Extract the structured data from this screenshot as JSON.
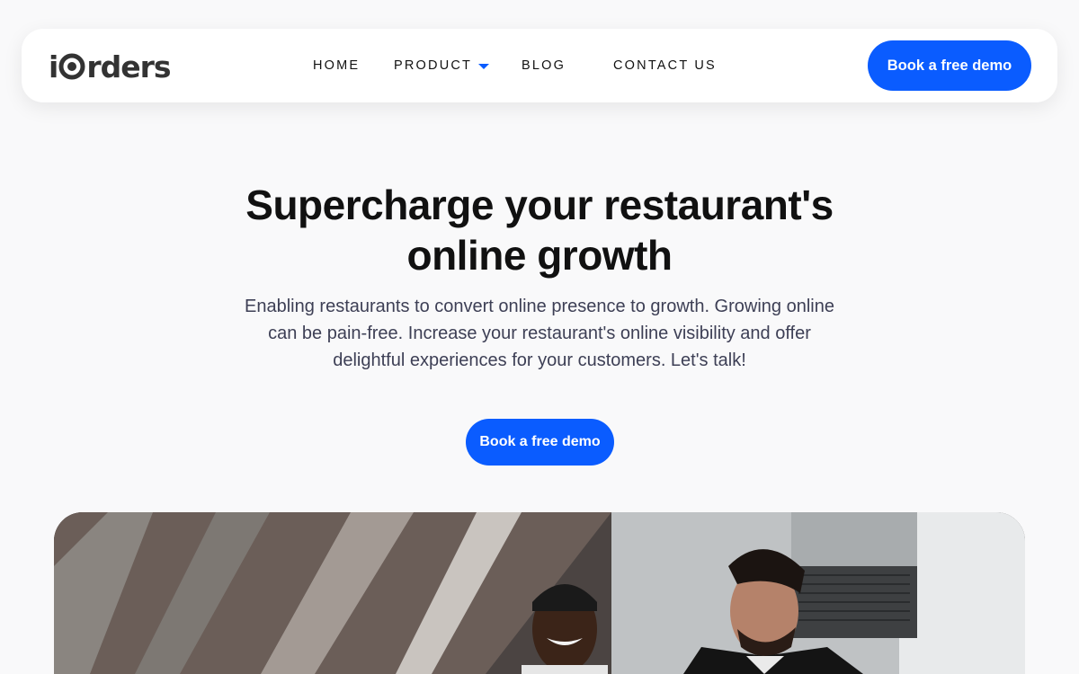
{
  "brand": {
    "logo_prefix": "i",
    "logo_suffix": "rders",
    "logo_icon": "target-o-icon",
    "accent_color": "#0a5cff"
  },
  "nav": {
    "items": [
      {
        "label": "HOME"
      },
      {
        "label": "PRODUCT",
        "has_dropdown": true
      },
      {
        "label": "BLOG"
      },
      {
        "label": "CONTACT US"
      }
    ],
    "cta_label": "Book a free demo"
  },
  "hero": {
    "title_line1": "Supercharge your restaurant's",
    "title_line2": "online growth",
    "subtitle": "Enabling restaurants to convert online presence to growth. Growing online can be pain-free. Increase your restaurant's online visibility and offer delightful experiences for your customers. Let's talk!",
    "cta_label": "Book a free demo",
    "image_icon": "restaurant-kitchen-photo"
  }
}
